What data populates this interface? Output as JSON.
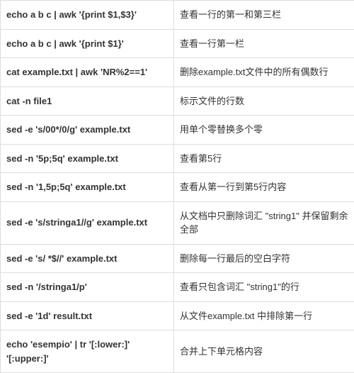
{
  "rows": [
    {
      "command": "echo a b c | awk '{print $1,$3}'",
      "description": "查看一行的第一和第三栏"
    },
    {
      "command": "echo a b c | awk '{print $1}'",
      "description": "查看一行第一栏"
    },
    {
      "command": "cat example.txt | awk 'NR%2==1'",
      "description": "删除example.txt文件中的所有偶数行"
    },
    {
      "command": "cat -n file1",
      "description": "标示文件的行数"
    },
    {
      "command": "sed -e 's/00*/0/g' example.txt",
      "description": "用单个零替换多个零"
    },
    {
      "command": "sed -n '5p;5q' example.txt",
      "description": "查看第5行"
    },
    {
      "command": "sed -n '1,5p;5q' example.txt",
      "description": "查看从第一行到第5行内容"
    },
    {
      "command": "sed -e 's/stringa1//g' example.txt",
      "description": "从文档中只删除词汇 \"string1\" 并保留剩余全部"
    },
    {
      "command": "sed -e 's/ *$//' example.txt",
      "description": "删除每一行最后的空白字符"
    },
    {
      "command": "sed -n '/stringa1/p'",
      "description": "查看只包含词汇 \"string1\"的行"
    },
    {
      "command": "sed -e '1d' result.txt",
      "description": "从文件example.txt 中排除第一行"
    },
    {
      "command": "echo 'esempio' | tr '[:lower:]' '[:upper:]'",
      "description": "合并上下单元格内容"
    }
  ]
}
